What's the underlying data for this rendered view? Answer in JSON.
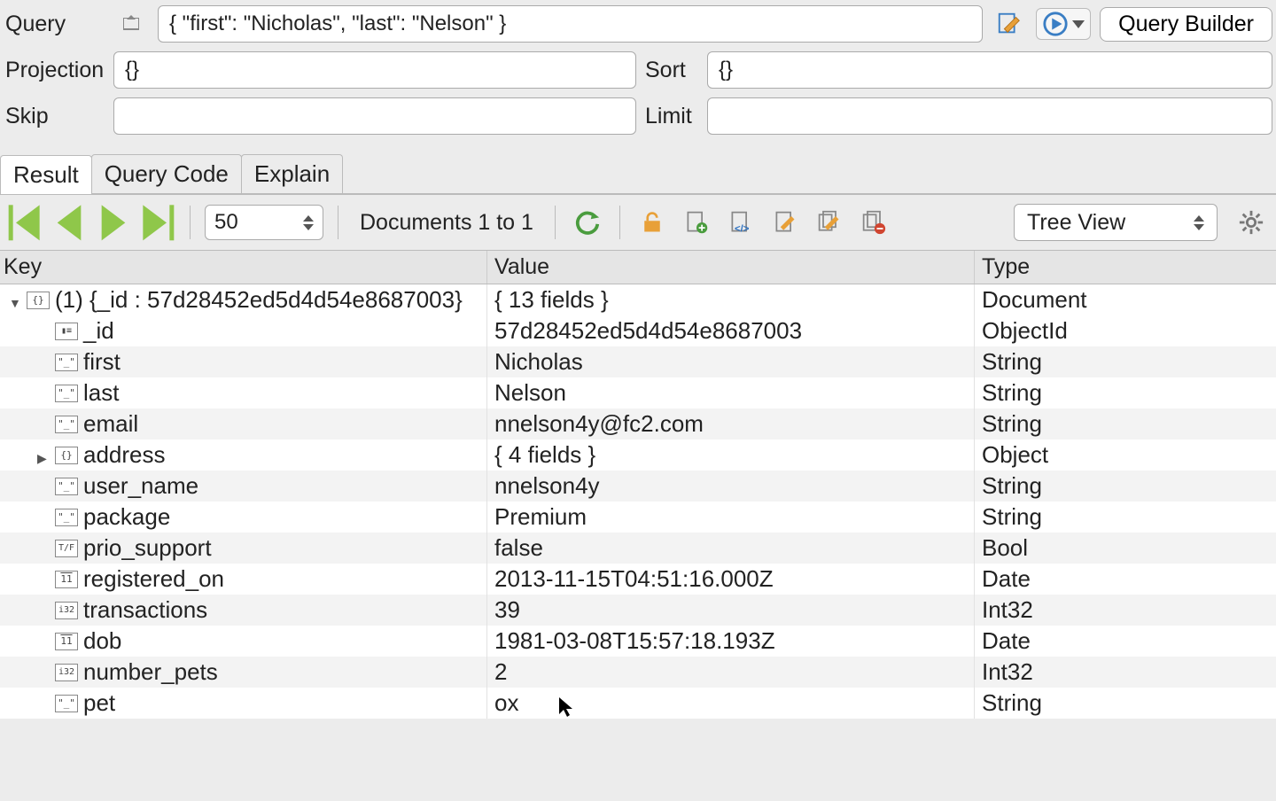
{
  "query_panel": {
    "query_label": "Query",
    "query_value": "{ \"first\": \"Nicholas\", \"last\": \"Nelson\" }",
    "projection_label": "Projection",
    "projection_value": "{}",
    "sort_label": "Sort",
    "sort_value": "{}",
    "skip_label": "Skip",
    "skip_value": "",
    "limit_label": "Limit",
    "limit_value": "",
    "query_builder_label": "Query Builder"
  },
  "tabs": {
    "result": "Result",
    "query_code": "Query Code",
    "explain": "Explain"
  },
  "toolbar": {
    "page_size": "50",
    "doc_range": "Documents 1 to 1",
    "view_mode": "Tree View"
  },
  "columns": {
    "key": "Key",
    "value": "Value",
    "type": "Type"
  },
  "doc": {
    "root_key": "(1) {_id : 57d28452ed5d4d54e8687003}",
    "root_value": "{ 13 fields }",
    "root_type": "Document",
    "fields": [
      {
        "icon": "id",
        "key": "_id",
        "value": "57d28452ed5d4d54e8687003",
        "type": "ObjectId"
      },
      {
        "icon": "str",
        "key": "first",
        "value": "Nicholas",
        "type": "String"
      },
      {
        "icon": "str",
        "key": "last",
        "value": "Nelson",
        "type": "String"
      },
      {
        "icon": "str",
        "key": "email",
        "value": "nnelson4y@fc2.com",
        "type": "String"
      },
      {
        "icon": "obj",
        "key": "address",
        "value": "{ 4 fields }",
        "type": "Object",
        "expandable": true
      },
      {
        "icon": "str",
        "key": "user_name",
        "value": "nnelson4y",
        "type": "String"
      },
      {
        "icon": "str",
        "key": "package",
        "value": "Premium",
        "type": "String"
      },
      {
        "icon": "bool",
        "key": "prio_support",
        "value": "false",
        "type": "Bool"
      },
      {
        "icon": "date",
        "key": "registered_on",
        "value": "2013-11-15T04:51:16.000Z",
        "type": "Date"
      },
      {
        "icon": "int",
        "key": "transactions",
        "value": "39",
        "type": "Int32"
      },
      {
        "icon": "date",
        "key": "dob",
        "value": "1981-03-08T15:57:18.193Z",
        "type": "Date"
      },
      {
        "icon": "int",
        "key": "number_pets",
        "value": "2",
        "type": "Int32"
      },
      {
        "icon": "str",
        "key": "pet",
        "value": "ox",
        "type": "String"
      }
    ]
  }
}
